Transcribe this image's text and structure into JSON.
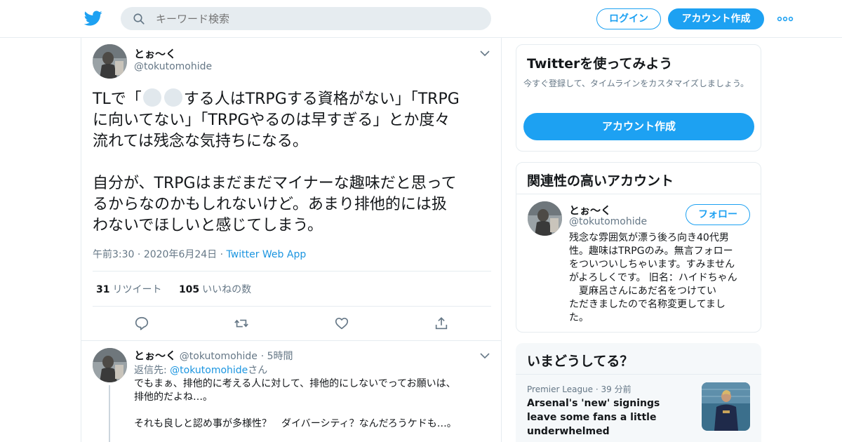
{
  "colors": {
    "accent": "#1da1f2",
    "link": "#1b95e0",
    "muted": "#657786",
    "border": "#e6ecf0"
  },
  "topbar": {
    "logo_icon": "twitter-bird-icon",
    "search_placeholder": "キーワード検索",
    "login_label": "ログイン",
    "signup_label": "アカウント作成",
    "more_icon": "more-dots-icon"
  },
  "tweet": {
    "name": "とぉ～く",
    "handle": "@tokutomohide",
    "text_line1_pre": "TLで「",
    "text_line1_post": "する人はTRPGする資格がない」「TRPG\nに向いてない」「TRPGやるのは早すぎる」とか度々\n流れては残念な気持ちになる。\n\n自分が、TRPGはまだまだマイナーな趣味だと思って\nるからなのかもしれないけど。あまり排他的には扱\nわないでほしいと感じてしまう。",
    "time": "午前3:30",
    "date": "2020年6月24日",
    "source": "Twitter Web App",
    "retweets": "31",
    "retweets_label": "リツイート",
    "likes": "105",
    "likes_label": "いいねの数"
  },
  "reply": {
    "name": "とぉ～く",
    "handle": "@tokutomohide",
    "age": "5時間",
    "reply_to_label": "返信先:",
    "reply_to_handle": "@tokutomohide",
    "reply_to_suffix": "さん",
    "text": "でもまぁ、排他的に考える人に対して、排他的にしないでってお願いは、\n排他的だよね…。\n\nそれも良しと認め事が多様性？　ダイバーシティ？なんだろうケドも…。"
  },
  "signup_card": {
    "title": "Twitterを使ってみよう",
    "subtitle": "今すぐ登録して、タイムラインをカスタマイズしましょう。",
    "cta": "アカウント作成"
  },
  "related_card": {
    "title": "関連性の高いアカウント",
    "name": "とぉ～く",
    "handle": "@tokutomohide",
    "follow_label": "フォロー",
    "bio": "残念な雰囲気が漂う後ろ向き40代男\n性。趣味はTRPGのみ。無言フォロー\nをついついしちゃいます。すみません\nがよろしくです。 旧名：ハイドちゃん\n　夏麻呂さんにあだ名をつけてい\nただきましたので名称変更してまし\nた。"
  },
  "trends_card": {
    "title": "いまどうしてる？",
    "source": "Premier League",
    "age": "39 分前",
    "headline": "Arsenal's 'new' signings leave some fans a little underwhelmed"
  }
}
